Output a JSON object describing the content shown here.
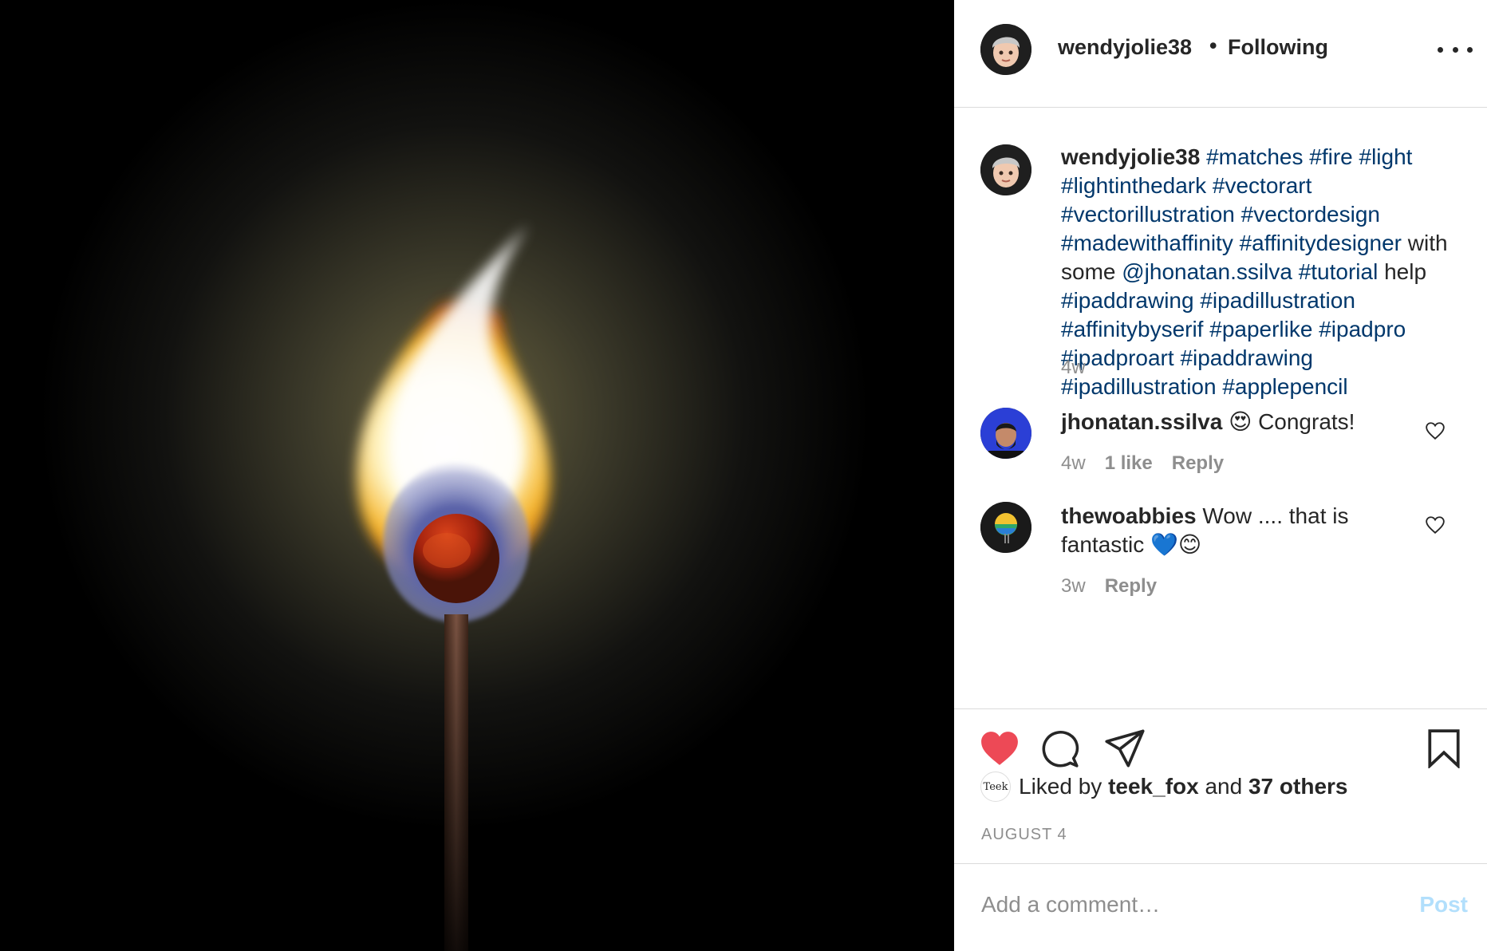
{
  "header": {
    "username": "wendyjolie38",
    "separator": "•",
    "follow_status": "Following",
    "more_icon": "ellipsis-icon"
  },
  "caption": {
    "username": "wendyjolie38",
    "segments": [
      {
        "text": "#matches",
        "type": "tag"
      },
      {
        "text": " ",
        "type": "plain"
      },
      {
        "text": "#fire",
        "type": "tag"
      },
      {
        "text": " ",
        "type": "plain"
      },
      {
        "text": "#light",
        "type": "tag"
      },
      {
        "text": " ",
        "type": "plain"
      },
      {
        "text": "#lightinthedark",
        "type": "tag"
      },
      {
        "text": " ",
        "type": "plain"
      },
      {
        "text": "#vectorart",
        "type": "tag"
      },
      {
        "text": " ",
        "type": "plain"
      },
      {
        "text": "#vectorillustration",
        "type": "tag"
      },
      {
        "text": " ",
        "type": "plain"
      },
      {
        "text": "#vectordesign",
        "type": "tag"
      },
      {
        "text": " ",
        "type": "plain"
      },
      {
        "text": "#madewithaffinity",
        "type": "tag"
      },
      {
        "text": " ",
        "type": "plain"
      },
      {
        "text": "#affinitydesigner",
        "type": "tag"
      },
      {
        "text": " with some ",
        "type": "plain"
      },
      {
        "text": "@jhonatan.ssilva",
        "type": "tag"
      },
      {
        "text": " ",
        "type": "plain"
      },
      {
        "text": "#tutorial",
        "type": "tag"
      },
      {
        "text": " help ",
        "type": "plain"
      },
      {
        "text": "#ipaddrawing",
        "type": "tag"
      },
      {
        "text": " ",
        "type": "plain"
      },
      {
        "text": "#ipadillustration",
        "type": "tag"
      },
      {
        "text": " ",
        "type": "plain"
      },
      {
        "text": "#affinitybyserif",
        "type": "tag"
      },
      {
        "text": " ",
        "type": "plain"
      },
      {
        "text": "#paperlike",
        "type": "tag"
      },
      {
        "text": " ",
        "type": "plain"
      },
      {
        "text": "#ipadpro",
        "type": "tag"
      },
      {
        "text": " ",
        "type": "plain"
      },
      {
        "text": "#ipadproart",
        "type": "tag"
      },
      {
        "text": " ",
        "type": "plain"
      },
      {
        "text": "#ipaddrawing",
        "type": "tag"
      },
      {
        "text": " ",
        "type": "plain"
      },
      {
        "text": "#ipadillustration",
        "type": "tag"
      },
      {
        "text": " ",
        "type": "plain"
      },
      {
        "text": "#applepencil",
        "type": "tag"
      }
    ],
    "time": "4w"
  },
  "comments": [
    {
      "username": "jhonatan.ssilva",
      "emoji": "😍",
      "text": "Congrats!",
      "time": "4w",
      "likes": "1 like",
      "reply": "Reply"
    },
    {
      "username": "thewoabbies",
      "text": "Wow .... that is fantastic 💙😊",
      "time": "3w",
      "reply": "Reply"
    }
  ],
  "actions": {
    "like_icon": "heart-filled-icon",
    "comment_icon": "comment-bubble-icon",
    "share_icon": "paper-plane-icon",
    "save_icon": "bookmark-icon",
    "liked_prefix": "Liked by",
    "liked_user": "teek_fox",
    "liked_joiner": "and",
    "liked_others": "37 others",
    "liker_avatar_text": "Teek",
    "date": "AUGUST 4"
  },
  "add_comment": {
    "placeholder": "Add a comment…",
    "post_label": "Post"
  },
  "colors": {
    "heart": "#ed4956",
    "hashtag": "#00376b",
    "muted": "#8e8e8e",
    "post_disabled": "#b2dffc"
  }
}
